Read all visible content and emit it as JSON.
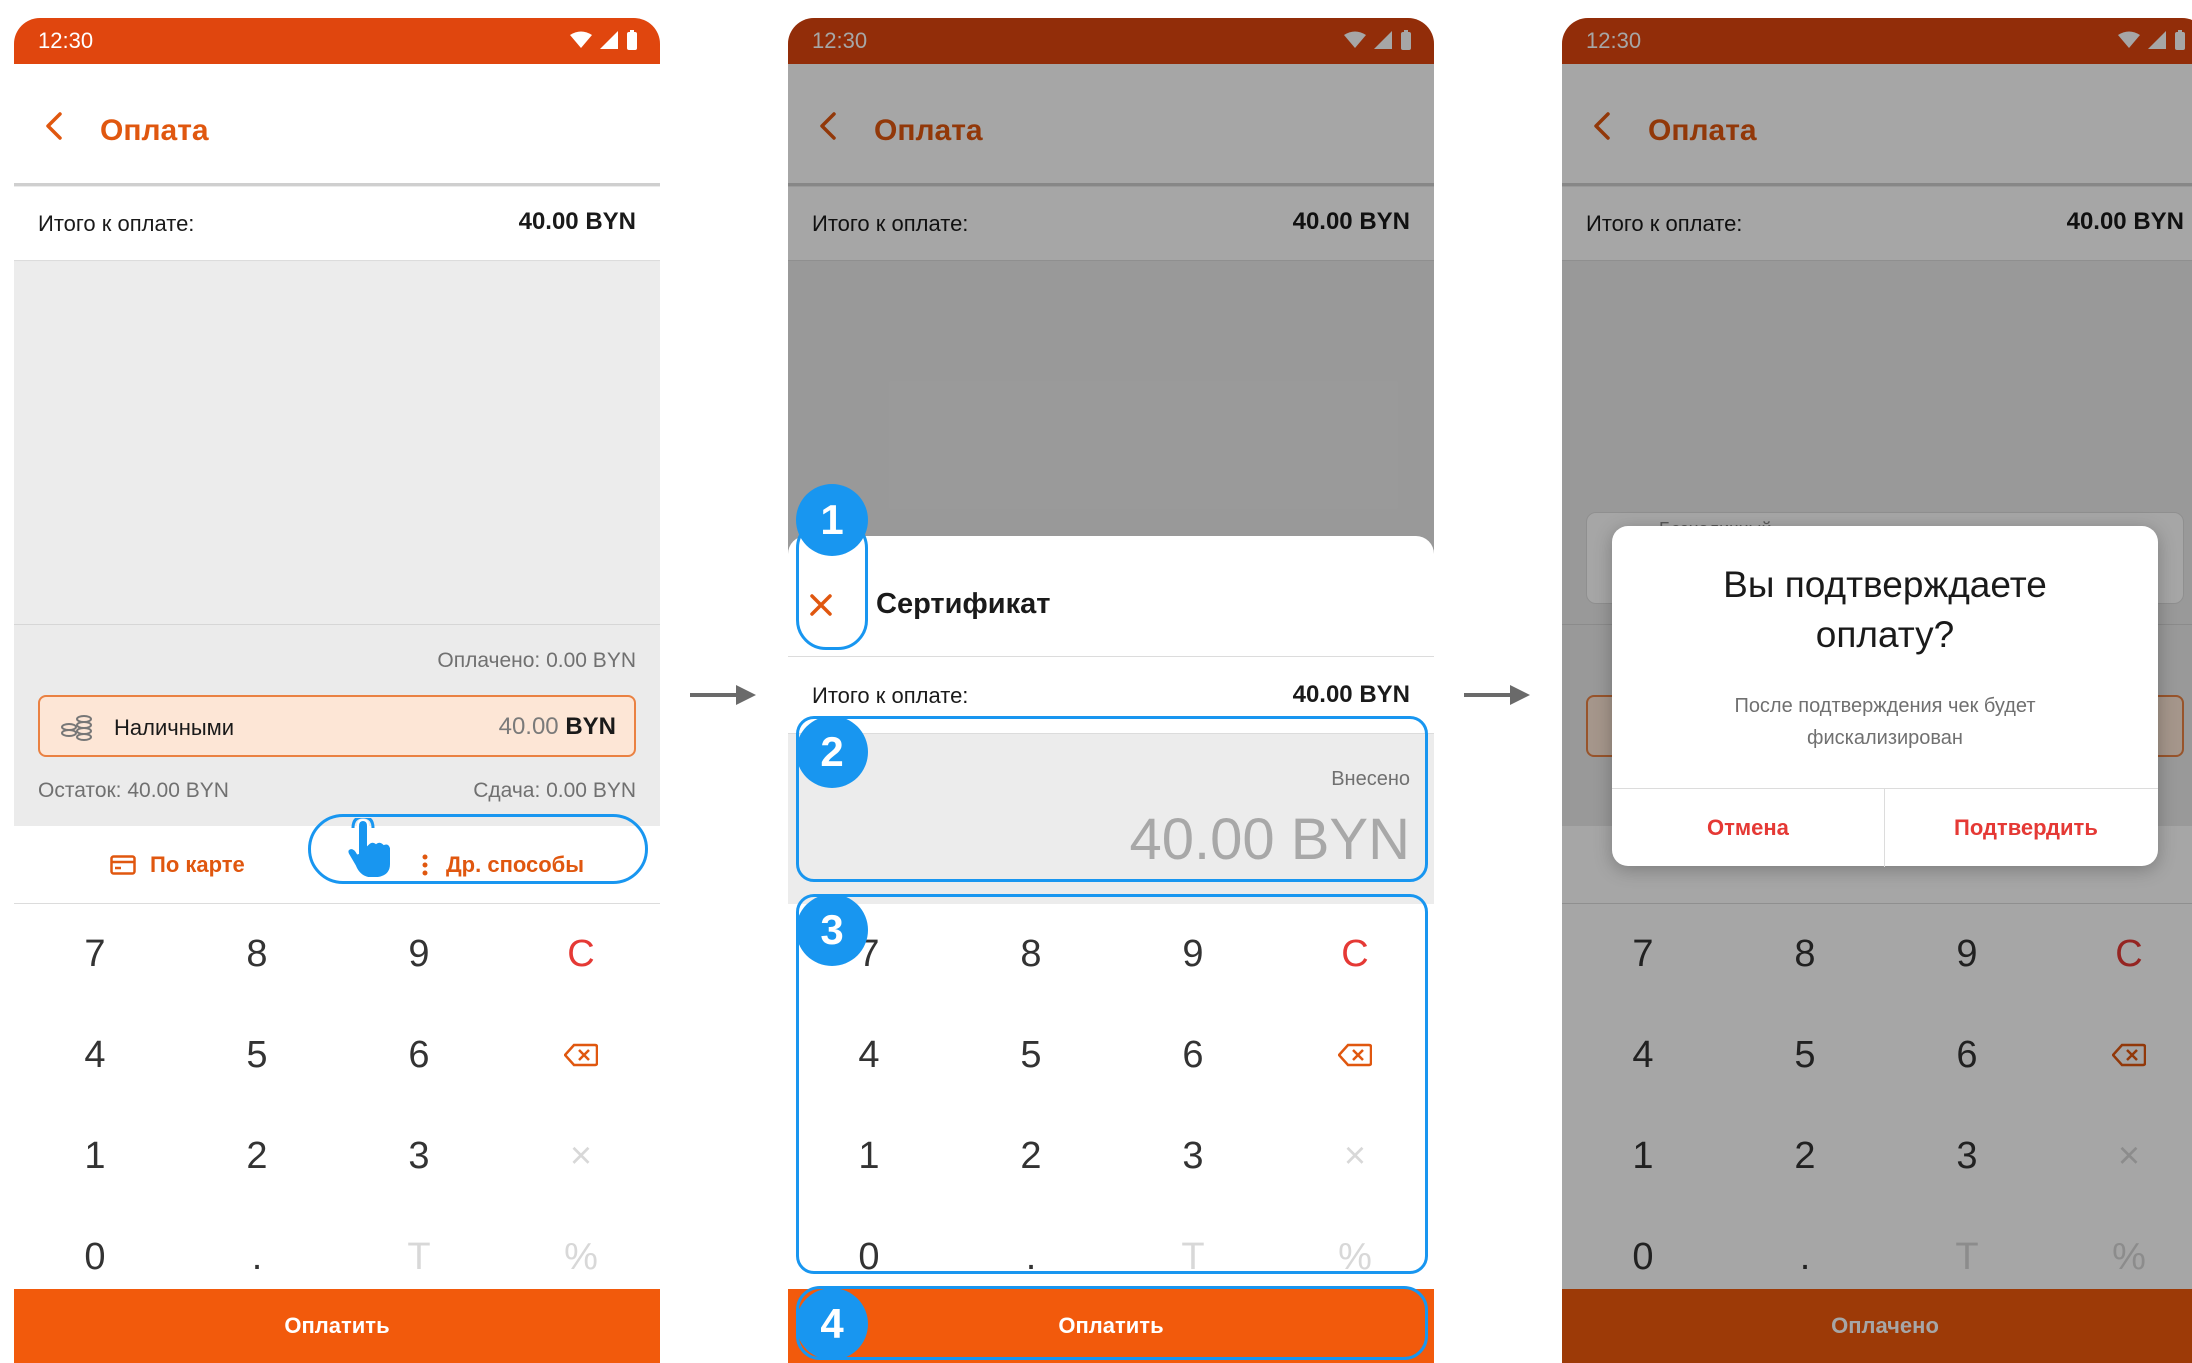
{
  "status": {
    "time": "12:30"
  },
  "header": {
    "title": "Оплата"
  },
  "total": {
    "label": "Итого к оплате:",
    "value": "40.00 BYN"
  },
  "summary": {
    "paid": "Оплачено: 0.00 BYN",
    "cash_label": "Наличными",
    "cash_amount": "40.00",
    "cash_currency": "BYN",
    "rest": "Остаток: 40.00 BYN",
    "change": "Сдача: 0.00 BYN"
  },
  "methods": {
    "card": "По карте",
    "other": "Др. способы"
  },
  "keypad": [
    "7",
    "8",
    "9",
    "C",
    "4",
    "5",
    "6",
    "⌫",
    "1",
    "2",
    "3",
    "×",
    "0",
    ".",
    "T",
    "%"
  ],
  "pay_button": "Оплатить",
  "paid_button": "Оплачено",
  "sheet": {
    "title": "Сертификат",
    "entered_label": "Внесено",
    "entered_value": "40.00 BYN"
  },
  "badges": [
    "1",
    "2",
    "3",
    "4"
  ],
  "background_card": "Безналичный",
  "dialog": {
    "title_line1": "Вы подтверждаете",
    "title_line2": "оплату?",
    "subtitle_line1": "После подтверждения чек будет",
    "subtitle_line2": "фискализирован",
    "cancel": "Отмена",
    "confirm": "Подтвердить"
  },
  "colors": {
    "accent": "#f25a0c",
    "status_bar": "#e0460e",
    "highlight": "#1896f0",
    "danger": "#e53935"
  }
}
